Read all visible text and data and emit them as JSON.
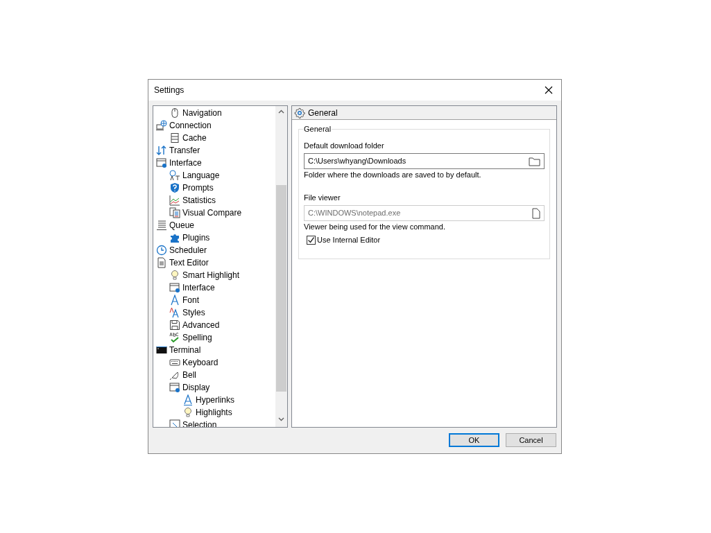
{
  "window": {
    "title": "Settings"
  },
  "tree": [
    {
      "children": [
        {
          "label": "Navigation"
        }
      ]
    },
    {
      "label": "Connection",
      "children": [
        {
          "label": "Cache"
        }
      ]
    },
    {
      "label": "Transfer"
    },
    {
      "label": "Interface",
      "children": [
        {
          "label": "Language"
        },
        {
          "label": "Prompts"
        },
        {
          "label": "Statistics"
        },
        {
          "label": "Visual Compare"
        }
      ]
    },
    {
      "label": "Queue",
      "children": [
        {
          "label": "Plugins"
        }
      ]
    },
    {
      "label": "Scheduler"
    },
    {
      "label": "Text Editor",
      "children": [
        {
          "label": "Smart Highlight"
        },
        {
          "label": "Interface"
        },
        {
          "label": "Font"
        },
        {
          "label": "Styles"
        },
        {
          "label": "Advanced"
        },
        {
          "label": "Spelling"
        }
      ]
    },
    {
      "label": "Terminal",
      "children": [
        {
          "label": "Keyboard"
        },
        {
          "label": "Bell"
        },
        {
          "label": "Display",
          "children": [
            {
              "label": "Hyperlinks"
            },
            {
              "label": "Highlights"
            }
          ]
        },
        {
          "label": "Selection"
        }
      ]
    }
  ],
  "panel": {
    "title": "General",
    "group": {
      "title": "General",
      "fields": [
        {
          "label": "Default download folder",
          "value": "C:\\Users\\whyang\\Downloads",
          "disabled": false,
          "hint": "Folder where the downloads are saved to by default."
        },
        {
          "label": "File viewer",
          "value": "C:\\WINDOWS\\notepad.exe",
          "disabled": true,
          "hint": "Viewer being used for the view command."
        }
      ],
      "checkbox": {
        "label": "Use Internal Editor",
        "checked": true
      }
    }
  },
  "buttons": [
    {
      "label": "OK",
      "default": true
    },
    {
      "label": "Cancel",
      "default": false
    }
  ]
}
